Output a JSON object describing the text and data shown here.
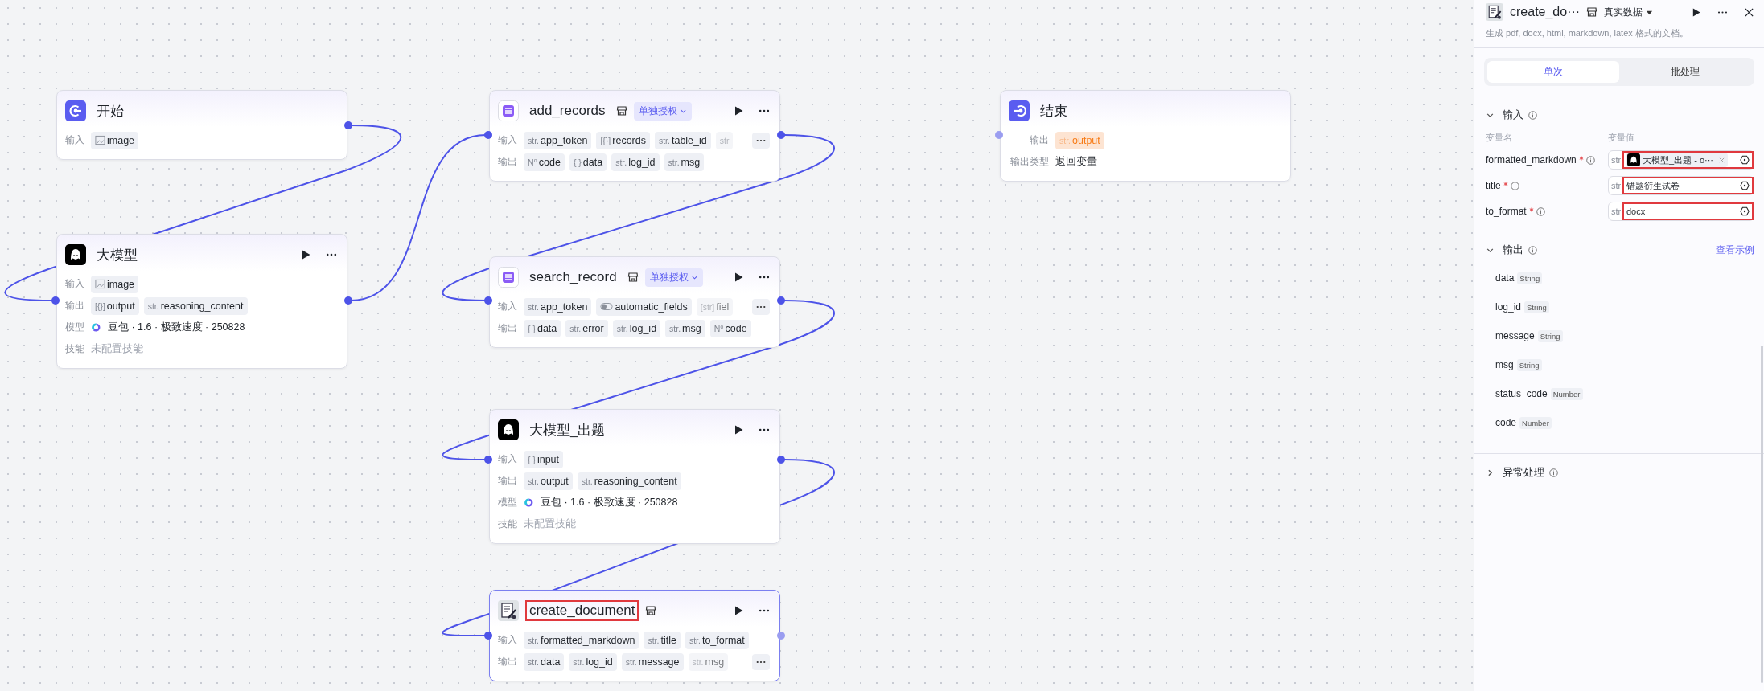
{
  "canvas": {
    "nodes": [
      {
        "kind": "start",
        "title": "开始",
        "selected": false,
        "rows": [
          {
            "kind": "tags",
            "label": "输入",
            "tags": [
              {
                "kind": "image",
                "name": "image"
              }
            ]
          }
        ]
      },
      {
        "kind": "llm",
        "title": "大模型",
        "selected": false,
        "rows": [
          {
            "kind": "tags",
            "label": "输入",
            "tags": [
              {
                "kind": "image",
                "name": "image"
              }
            ]
          },
          {
            "kind": "tags",
            "label": "输出",
            "tags": [
              {
                "kind": "typed",
                "prefix": "[{}]",
                "name": "output"
              },
              {
                "kind": "typed",
                "prefix": "str.",
                "name": "reasoning_content"
              }
            ]
          },
          {
            "kind": "model",
            "label": "模型",
            "text": "豆包 · 1.6 · 极致速度 · 250828"
          },
          {
            "kind": "note",
            "label": "技能",
            "text": "未配置技能"
          }
        ]
      },
      {
        "kind": "plugin",
        "title": "add_records",
        "auth": "单独授权",
        "selected": false,
        "rows": [
          {
            "kind": "tags",
            "label": "输入",
            "has_more": true,
            "tags": [
              {
                "kind": "typed",
                "prefix": "str.",
                "name": "app_token"
              },
              {
                "kind": "typed",
                "prefix": "[{}]",
                "name": "records"
              },
              {
                "kind": "typed",
                "prefix": "str.",
                "name": "table_id"
              },
              {
                "kind": "typed",
                "prefix": "str",
                "faded": true
              }
            ]
          },
          {
            "kind": "tags",
            "label": "输出",
            "tags": [
              {
                "kind": "typed",
                "prefix": "N⁰",
                "name": "code"
              },
              {
                "kind": "typed",
                "prefix": "{ }",
                "name": "data"
              },
              {
                "kind": "typed",
                "prefix": "str.",
                "name": "log_id"
              },
              {
                "kind": "typed",
                "prefix": "str.",
                "name": "msg"
              }
            ]
          }
        ]
      },
      {
        "kind": "plugin",
        "title": "search_record",
        "auth": "单独授权",
        "selected": false,
        "rows": [
          {
            "kind": "tags",
            "label": "输入",
            "has_more": true,
            "tags": [
              {
                "kind": "typed",
                "prefix": "str.",
                "name": "app_token"
              },
              {
                "kind": "bool",
                "name": "automatic_fields"
              },
              {
                "kind": "typed",
                "prefix": "[str]",
                "name": "fiel",
                "faded": true
              }
            ]
          },
          {
            "kind": "tags",
            "label": "输出",
            "tags": [
              {
                "kind": "typed",
                "prefix": "{ }",
                "name": "data"
              },
              {
                "kind": "typed",
                "prefix": "str.",
                "name": "error"
              },
              {
                "kind": "typed",
                "prefix": "str.",
                "name": "log_id"
              },
              {
                "kind": "typed",
                "prefix": "str.",
                "name": "msg"
              },
              {
                "kind": "typed",
                "prefix": "N⁰",
                "name": "code"
              }
            ]
          }
        ]
      },
      {
        "kind": "llm",
        "title": "大模型_出题",
        "selected": false,
        "rows": [
          {
            "kind": "tags",
            "label": "输入",
            "tags": [
              {
                "kind": "typed",
                "prefix": "{ }",
                "name": "input"
              }
            ]
          },
          {
            "kind": "tags",
            "label": "输出",
            "tags": [
              {
                "kind": "typed",
                "prefix": "str.",
                "name": "output"
              },
              {
                "kind": "typed",
                "prefix": "str.",
                "name": "reasoning_content"
              }
            ]
          },
          {
            "kind": "model",
            "label": "模型",
            "text": "豆包 · 1.6 · 极致速度 · 250828"
          },
          {
            "kind": "note",
            "label": "技能",
            "text": "未配置技能"
          }
        ]
      },
      {
        "kind": "document",
        "title": "create_document",
        "selected": true,
        "highlighted": true,
        "rows": [
          {
            "kind": "tags",
            "label": "输入",
            "tags": [
              {
                "kind": "typed",
                "prefix": "str.",
                "name": "formatted_markdown"
              },
              {
                "kind": "typed",
                "prefix": "str.",
                "name": "title"
              },
              {
                "kind": "typed",
                "prefix": "str.",
                "name": "to_format"
              }
            ]
          },
          {
            "kind": "tags",
            "label": "输出",
            "has_more": true,
            "tags": [
              {
                "kind": "typed",
                "prefix": "str.",
                "name": "data"
              },
              {
                "kind": "typed",
                "prefix": "str.",
                "name": "log_id"
              },
              {
                "kind": "typed",
                "prefix": "str.",
                "name": "message"
              },
              {
                "kind": "typed",
                "prefix": "str.",
                "name": "msg",
                "faded": true
              }
            ]
          }
        ]
      },
      {
        "kind": "end",
        "title": "结束",
        "selected": false,
        "rows": [
          {
            "kind": "tags",
            "label": "输出",
            "tags": [
              {
                "kind": "typed",
                "prefix": "str.",
                "name": "output",
                "accent": true
              }
            ]
          },
          {
            "kind": "text",
            "label": "输出类型",
            "text": "返回变量"
          }
        ]
      }
    ]
  },
  "panel": {
    "title": "create_do···",
    "mode": "真实数据",
    "description": "生成 pdf, docx, html, markdown, latex 格式的文档。",
    "tabs": [
      {
        "label": "单次",
        "selected": true
      },
      {
        "label": "批处理",
        "selected": false
      }
    ],
    "input_section": {
      "title": "输入",
      "expanded": true,
      "columns": [
        "变量名",
        "变量值"
      ],
      "params": [
        {
          "name": "formatted_markdown",
          "required": true,
          "type": "str",
          "highlighted": true,
          "value": {
            "kind": "reference",
            "text": "大模型_出题 - o···"
          }
        },
        {
          "name": "title",
          "required": true,
          "type": "str",
          "highlighted": true,
          "value": {
            "kind": "literal",
            "text": "错题衍生试卷"
          }
        },
        {
          "name": "to_format",
          "required": true,
          "type": "str",
          "highlighted": true,
          "value": {
            "kind": "literal",
            "text": "docx"
          }
        }
      ]
    },
    "output_section": {
      "title": "输出",
      "expanded": true,
      "link": "查看示例",
      "fields": [
        {
          "name": "data",
          "type": "String"
        },
        {
          "name": "log_id",
          "type": "String"
        },
        {
          "name": "message",
          "type": "String"
        },
        {
          "name": "msg",
          "type": "String"
        },
        {
          "name": "status_code",
          "type": "Number"
        },
        {
          "name": "code",
          "type": "Number"
        }
      ]
    },
    "error_section": {
      "title": "异常处理",
      "expanded": false
    }
  }
}
